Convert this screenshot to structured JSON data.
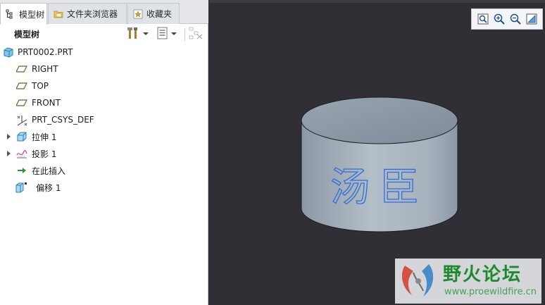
{
  "tabs": [
    {
      "label": "模型树"
    },
    {
      "label": "文件夹浏览器"
    },
    {
      "label": "收藏夹"
    }
  ],
  "toolbar": {
    "title": "模型树"
  },
  "tree": {
    "items": [
      {
        "label": "PRT0002.PRT",
        "icon": "part-icon"
      },
      {
        "label": "RIGHT",
        "icon": "datum-plane-icon"
      },
      {
        "label": "TOP",
        "icon": "datum-plane-icon"
      },
      {
        "label": "FRONT",
        "icon": "datum-plane-icon"
      },
      {
        "label": "PRT_CSYS_DEF",
        "icon": "coordinate-system-icon"
      },
      {
        "label": "拉伸 1",
        "icon": "extrude-icon"
      },
      {
        "label": "投影 1",
        "icon": "projection-icon"
      },
      {
        "label": "在此插入",
        "icon": "insert-here-arrow-icon"
      },
      {
        "label": "偏移 1",
        "icon": "offset-icon"
      }
    ]
  },
  "model": {
    "engraved_text": "汤臣",
    "colors": {
      "cylinder": "#a9b3bd",
      "text_outline": "#2f6fd8",
      "background": "#2f2f35"
    }
  },
  "watermark": {
    "title": "野火论坛",
    "url": "www.proewildfire.cn"
  }
}
